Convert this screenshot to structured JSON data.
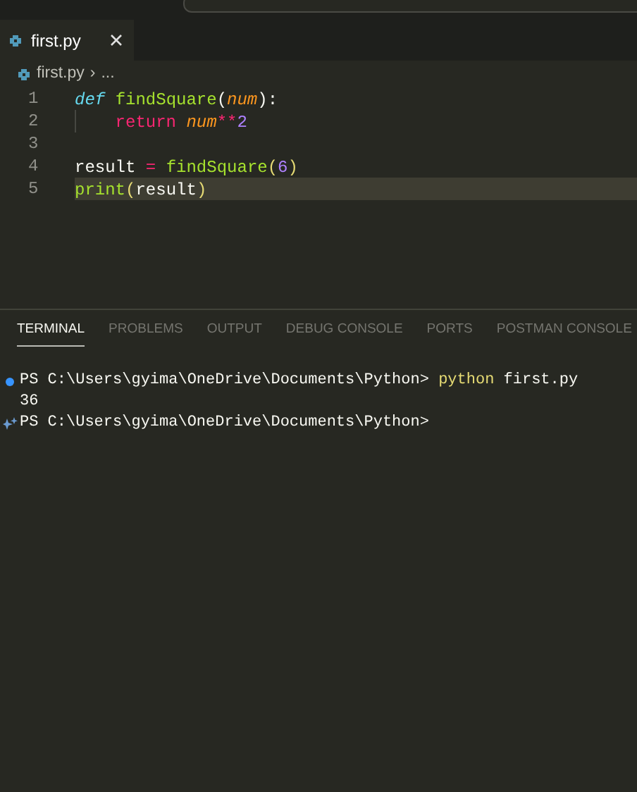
{
  "tabs": [
    {
      "label": "first.py",
      "selected": true
    }
  ],
  "breadcrumb": {
    "file": "first.py",
    "separator": "›",
    "more": "..."
  },
  "code_lines": [
    {
      "number": "1",
      "current": false,
      "indent_guide": false,
      "tokens": [
        {
          "kind": "storage",
          "text": "def "
        },
        {
          "kind": "function",
          "text": "findSquare"
        },
        {
          "kind": "punct",
          "text": "("
        },
        {
          "kind": "param",
          "text": "num"
        },
        {
          "kind": "punct",
          "text": "):"
        }
      ]
    },
    {
      "number": "2",
      "current": false,
      "indent_guide": true,
      "tokens": [
        {
          "kind": "keyword",
          "text": "    return "
        },
        {
          "kind": "param",
          "text": "num"
        },
        {
          "kind": "keyword",
          "text": "**"
        },
        {
          "kind": "number",
          "text": "2"
        }
      ]
    },
    {
      "number": "3",
      "current": false,
      "indent_guide": false
    },
    {
      "number": "4",
      "current": false,
      "indent_guide": false,
      "tokens": [
        {
          "kind": "plain",
          "text": "result "
        },
        {
          "kind": "keyword",
          "text": "= "
        },
        {
          "kind": "function",
          "text": "findSquare"
        },
        {
          "kind": "paren",
          "text": "("
        },
        {
          "kind": "number",
          "text": "6"
        },
        {
          "kind": "paren",
          "text": ")"
        }
      ]
    },
    {
      "number": "5",
      "current": true,
      "indent_guide": false,
      "tokens": [
        {
          "kind": "function",
          "text": "print"
        },
        {
          "kind": "paren",
          "text": "("
        },
        {
          "kind": "plain",
          "text": "result"
        },
        {
          "kind": "paren",
          "text": ")"
        }
      ]
    }
  ],
  "panel_tabs": [
    {
      "label": "TERMINAL",
      "selected": true
    },
    {
      "label": "PROBLEMS",
      "selected": false
    },
    {
      "label": "OUTPUT",
      "selected": false
    },
    {
      "label": "DEBUG CONSOLE",
      "selected": false
    },
    {
      "label": "PORTS",
      "selected": false
    },
    {
      "label": "POSTMAN CONSOLE",
      "selected": false
    }
  ],
  "terminal_lines": [
    {
      "success_dot": true,
      "sparkle": false,
      "tokens": [
        {
          "kind": "plain",
          "text": "PS C:\\Users\\gyima\\OneDrive\\Documents\\Python> "
        },
        {
          "kind": "command",
          "text": "python"
        },
        {
          "kind": "plain",
          "text": " first.py"
        }
      ]
    },
    {
      "success_dot": false,
      "sparkle": false,
      "tokens": [
        {
          "kind": "plain",
          "text": "36"
        }
      ]
    },
    {
      "success_dot": false,
      "sparkle": true,
      "tokens": [
        {
          "kind": "plain",
          "text": "PS C:\\Users\\gyima\\OneDrive\\Documents\\Python>"
        }
      ]
    }
  ]
}
